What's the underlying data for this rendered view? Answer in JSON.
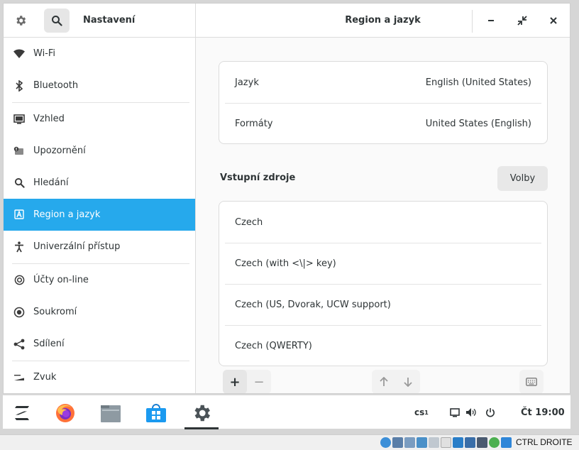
{
  "header": {
    "left_title": "Nastavení",
    "right_title": "Region a jazyk",
    "icons": [
      "gear-icon",
      "search-icon",
      "minimize-icon",
      "restore-icon",
      "close-icon"
    ]
  },
  "sidebar": {
    "items": [
      {
        "label": "Wi-Fi",
        "icon": "wifi-icon"
      },
      {
        "label": "Bluetooth",
        "icon": "bluetooth-icon"
      },
      {
        "label": "Vzhled",
        "icon": "display-icon"
      },
      {
        "label": "Upozornění",
        "icon": "notification-icon"
      },
      {
        "label": "Hledání",
        "icon": "search-icon"
      },
      {
        "label": "Region a jazyk",
        "icon": "region-icon",
        "active": true
      },
      {
        "label": "Univerzální přístup",
        "icon": "accessibility-icon"
      },
      {
        "label": "Účty on-line",
        "icon": "online-accounts-icon"
      },
      {
        "label": "Soukromí",
        "icon": "privacy-icon"
      },
      {
        "label": "Sdílení",
        "icon": "share-icon"
      },
      {
        "label": "Zvuk",
        "icon": "sound-icon"
      }
    ]
  },
  "language": {
    "rows": [
      {
        "key": "Jazyk",
        "value": "English (United States)"
      },
      {
        "key": "Formáty",
        "value": "United States (English)"
      }
    ]
  },
  "input_sources": {
    "title": "Vstupní zdroje",
    "options_label": "Volby",
    "items": [
      "Czech",
      "Czech (with <\\|> key)",
      "Czech (US, Dvorak, UCW support)",
      "Czech (QWERTY)"
    ],
    "toolbar": {
      "add": "+",
      "remove": "−"
    }
  },
  "taskbar": {
    "apps": [
      "zorin-menu-icon",
      "firefox-icon",
      "files-icon",
      "software-store-icon",
      "settings-icon"
    ],
    "keyboard_layout": "cs",
    "keyboard_layout_sub": "1",
    "clock": "Čt 19:00"
  },
  "vm_status": {
    "host_key": "CTRL DROITE"
  },
  "colors": {
    "accent": "#26a9ec",
    "window_bg": "#fafafa"
  }
}
